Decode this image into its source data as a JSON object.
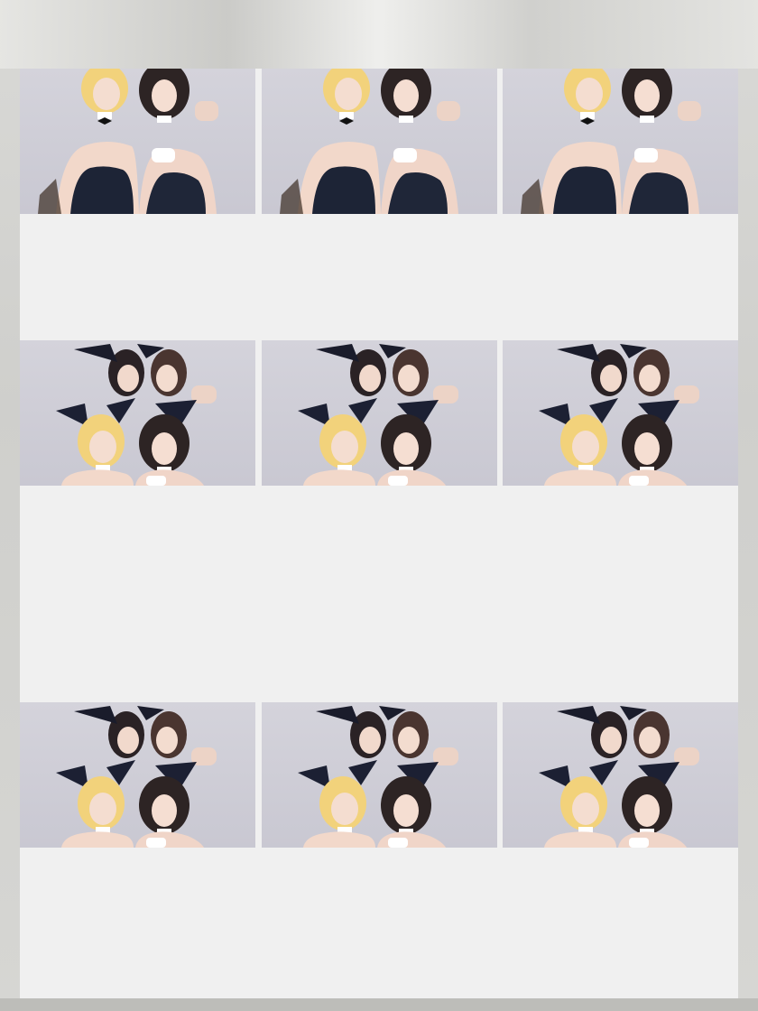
{
  "layout": {
    "rows": 3,
    "columns": 3
  },
  "photos": [
    {
      "variant": "cropped-top"
    },
    {
      "variant": "cropped-top"
    },
    {
      "variant": "cropped-top"
    },
    {
      "variant": "full-ears"
    },
    {
      "variant": "full-ears"
    },
    {
      "variant": "full-ears"
    },
    {
      "variant": "full-ears"
    },
    {
      "variant": "full-ears"
    },
    {
      "variant": "full-ears"
    }
  ]
}
